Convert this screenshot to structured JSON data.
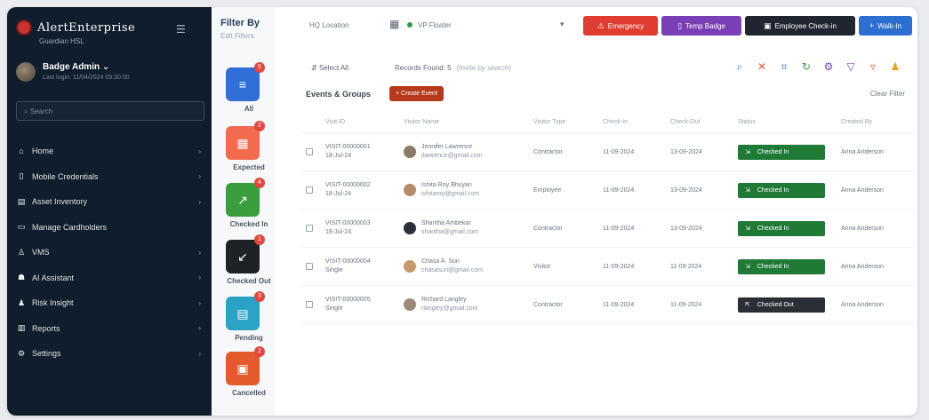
{
  "colors": {
    "sidebar_bg": "#0f1d2c",
    "emergency": "#e03c31",
    "temp_badge": "#7b3fb5",
    "employee_checkin": "#1f2630",
    "walkin": "#2d6fd0",
    "checked_in": "#1f7a35",
    "checked_out": "#2b2f35",
    "events_btn": "#b63a1e"
  },
  "sidebar": {
    "brand": "AlertEnterprise",
    "brand_sub": "Guardian HSL",
    "collapse_icon": "menu-icon",
    "user_name": "Badge Admin",
    "user_sub": "Last login: 11/04/2024 09:30:00",
    "search_placeholder": "Search",
    "items": [
      {
        "label": "Home",
        "icon": "home-icon",
        "chevron": "›"
      },
      {
        "label": "Mobile Credentials",
        "icon": "mobile-icon",
        "chevron": "›"
      },
      {
        "label": "Asset Inventory",
        "icon": "inventory-icon",
        "chevron": "›"
      },
      {
        "label": "Manage Cardholders",
        "icon": "id-card-icon",
        "chevron": ""
      },
      {
        "label": "VMS",
        "icon": "visitor-icon",
        "chevron": "›"
      },
      {
        "label": "AI Assistant",
        "icon": "robot-icon",
        "chevron": "›"
      },
      {
        "label": "Risk Insight",
        "icon": "person-alert-icon",
        "chevron": "›"
      },
      {
        "label": "Reports",
        "icon": "reports-icon",
        "chevron": "›"
      },
      {
        "label": "Settings",
        "icon": "gear-icon",
        "chevron": "›"
      }
    ]
  },
  "filter": {
    "title": "Filter By",
    "subtitle": "Edit Filters",
    "items": [
      {
        "label": "All",
        "badge": "5",
        "color": "#2f6fd6",
        "icon": "all-icon",
        "glyph": "≡"
      },
      {
        "label": "Expected",
        "badge": "2",
        "color": "#f26b4f",
        "icon": "calendar-icon",
        "glyph": "▦"
      },
      {
        "label": "Checked In",
        "badge": "4",
        "color": "#3a9e3e",
        "icon": "check-in-icon",
        "glyph": "↗"
      },
      {
        "label": "Checked Out",
        "badge": "1",
        "color": "#1e2227",
        "icon": "check-out-icon",
        "glyph": "↙"
      },
      {
        "label": "Pending",
        "badge": "3",
        "color": "#2aa3c7",
        "icon": "pending-icon",
        "glyph": "▤"
      },
      {
        "label": "Cancelled",
        "badge": "2",
        "color": "#e45a2d",
        "icon": "cancelled-icon",
        "glyph": "▣"
      }
    ]
  },
  "topbar": {
    "location_placeholder": "HQ Location",
    "status_text": "VP Floater",
    "buttons": [
      {
        "label": "Emergency",
        "icon": "warning-icon",
        "glyph": "⚠"
      },
      {
        "label": "Temp Badge",
        "icon": "badge-icon",
        "glyph": "▯"
      },
      {
        "label": "Employee Check-in",
        "icon": "checkin-icon",
        "glyph": "▣"
      },
      {
        "label": "Walk-In",
        "icon": "walkin-icon",
        "glyph": "+"
      }
    ]
  },
  "toolbar": {
    "select_all": "Select All",
    "records": "Records Found: 5",
    "records_sub": "(Invite by search)",
    "icons": [
      {
        "name": "search-icon",
        "glyph": "⌕",
        "color": "#2d6fd0"
      },
      {
        "name": "filter-clear-icon",
        "glyph": "✕",
        "color": "#e45a2d"
      },
      {
        "name": "scan-icon",
        "glyph": "⌗",
        "color": "#2d6fd0"
      },
      {
        "name": "refresh-icon",
        "glyph": "↻",
        "color": "#3a9e3e"
      },
      {
        "name": "settings-icon",
        "glyph": "⚙",
        "color": "#7b3fb5"
      },
      {
        "name": "funnel-icon",
        "glyph": "▽",
        "color": "#7b3fb5"
      },
      {
        "name": "tag-icon",
        "glyph": "▿",
        "color": "#e45a2d"
      },
      {
        "name": "person-icon",
        "glyph": "♟",
        "color": "#e6a21f"
      }
    ]
  },
  "events": {
    "label": "Events & Groups",
    "button": "+ Create Event",
    "clear": "Clear Filter"
  },
  "table": {
    "headers": [
      "Visit ID",
      "Visitor Name",
      "Visitor Type",
      "Check-In",
      "Check-Out",
      "Status",
      "Created By"
    ],
    "rows": [
      {
        "id": "VISIT-00000001",
        "id2": "18-Jul-24",
        "name": "Jennifer Lawrence",
        "email": "jlawrence@gmail.com",
        "type": "Contractor",
        "date1": "11-09-2024",
        "date2": "13-09-2024",
        "status": "Checked In",
        "status_icon": "check-in-icon",
        "by": "Anna Anderson"
      },
      {
        "id": "VISIT-00000002",
        "id2": "18-Jul-24",
        "name": "Ishita Roy Bhuyan",
        "email": "ishitaroy@gmail.com",
        "type": "Employee",
        "date1": "11-09-2024",
        "date2": "13-09-2024",
        "status": "Checked In",
        "status_icon": "check-in-icon",
        "by": "Anna Anderson"
      },
      {
        "id": "VISIT-00000003",
        "id2": "18-Jul-24",
        "name": "Shantha Ambekar",
        "email": "shantha@gmail.com",
        "type": "Contractor",
        "date1": "11-09-2024",
        "date2": "13-09-2024",
        "status": "Checked In",
        "status_icon": "check-in-icon",
        "by": "Anna Anderson"
      },
      {
        "id": "VISIT-00000004",
        "id2": "Single",
        "name": "Chasa A. Sun",
        "email": "chasasun@gmail.com",
        "type": "Visitor",
        "date1": "11-09-2024",
        "date2": "11-09-2024",
        "status": "Checked In",
        "status_icon": "check-in-icon",
        "by": "Anna Anderson"
      },
      {
        "id": "VISIT-00000005",
        "id2": "Single",
        "name": "Richard Langley",
        "email": "rlangley@gmail.com",
        "type": "Contractor",
        "date1": "11-09-2024",
        "date2": "11-09-2024",
        "status": "Checked Out",
        "status_icon": "check-out-icon",
        "by": "Anna Anderson"
      }
    ]
  }
}
